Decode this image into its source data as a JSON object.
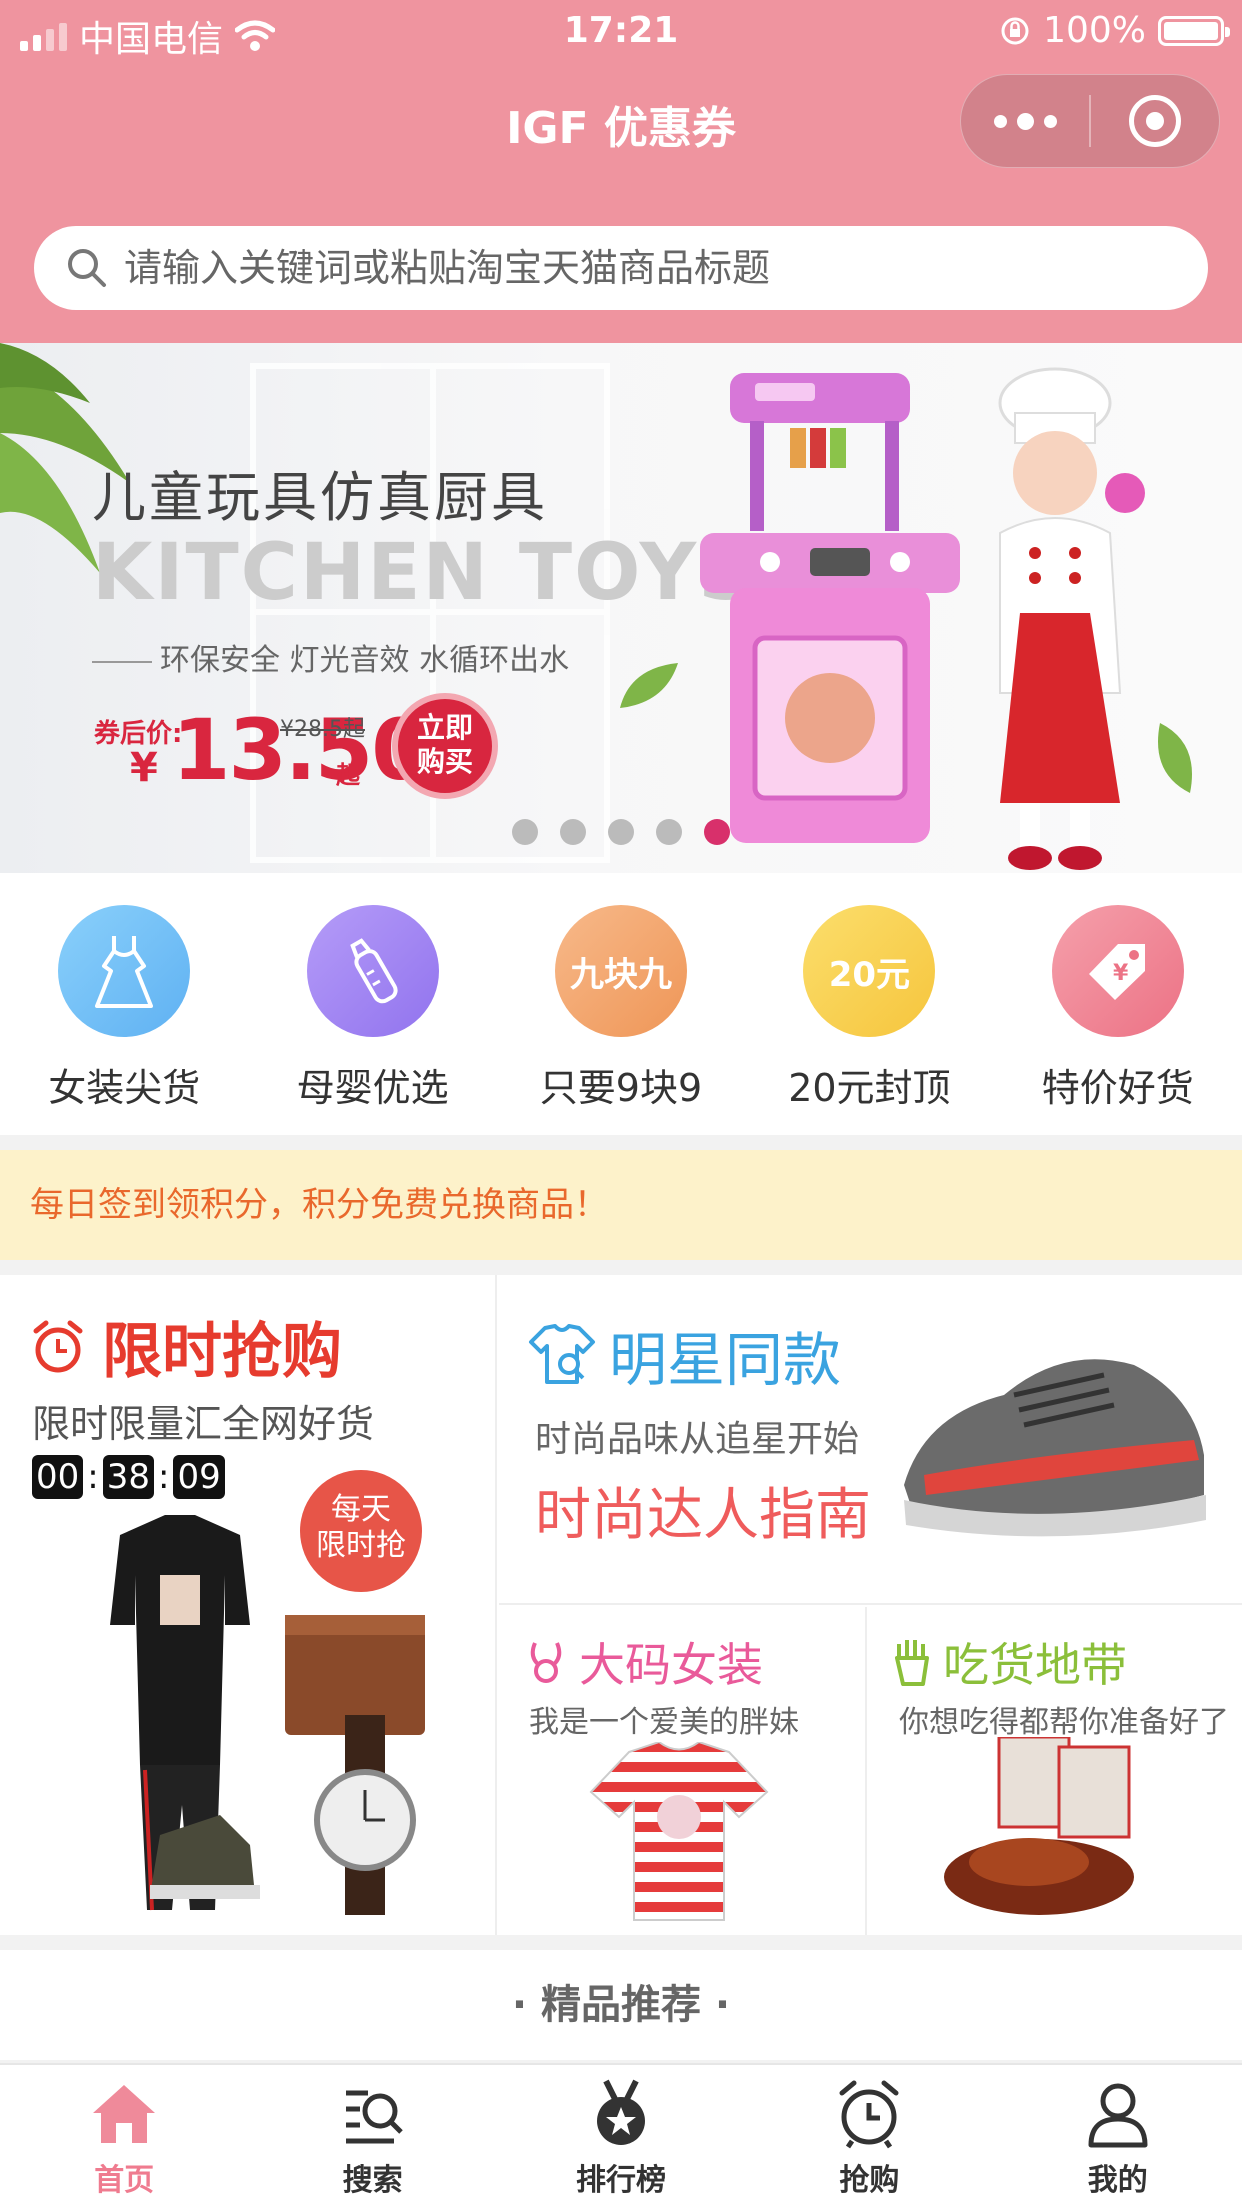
{
  "status_bar": {
    "carrier": "中国电信",
    "time": "17:21",
    "battery": "100%"
  },
  "nav": {
    "title": "IGF 优惠券"
  },
  "search": {
    "placeholder": "请输入关键词或粘贴淘宝天猫商品标题"
  },
  "banner": {
    "title": "儿童玩具仿真厨具",
    "english": "KITCHEN TOYS",
    "subtitle": "环保安全 灯光音效 水循环出水",
    "price_label": "券后价:",
    "currency": "¥",
    "price": "13.50",
    "price_suffix": "起",
    "old_price": "¥28.5起",
    "buy_label_1": "立即",
    "buy_label_2": "购买",
    "active_slide": 5,
    "slide_count": 5
  },
  "categories": [
    {
      "label": "女装尖货",
      "icon": "dress-icon",
      "color": "#7cc4f8"
    },
    {
      "label": "母婴优选",
      "icon": "baby-bottle-icon",
      "color": "#a98af5"
    },
    {
      "label": "只要9块9",
      "icon": "nine-nine-icon",
      "icon_text": "九块九",
      "color": "#f3a56a"
    },
    {
      "label": "20元封顶",
      "icon": "twenty-yuan-icon",
      "icon_text": "20元",
      "color": "#f8cd52"
    },
    {
      "label": "特价好货",
      "icon": "price-tag-icon",
      "color": "#f08595"
    }
  ],
  "notice": {
    "text": "每日签到领积分，积分免费兑换商品！"
  },
  "promo": {
    "flash": {
      "title": "限时抢购",
      "subtitle": "限时限量汇全网好货",
      "timer": [
        "00",
        "38",
        "09"
      ],
      "badge_1": "每天",
      "badge_2": "限时抢"
    },
    "star": {
      "title": "明星同款",
      "subtitle": "时尚品味从追星开始",
      "tagline": "时尚达人指南"
    },
    "plus": {
      "title": "大码女装",
      "subtitle": "我是一个爱美的胖妹"
    },
    "food": {
      "title": "吃货地带",
      "subtitle": "你想吃得都帮你准备好了"
    }
  },
  "recommend": {
    "title": "精品推荐"
  },
  "tabs": [
    {
      "label": "首页",
      "icon": "home-icon",
      "active": true
    },
    {
      "label": "搜索",
      "icon": "search-list-icon",
      "active": false
    },
    {
      "label": "排行榜",
      "icon": "medal-icon",
      "active": false
    },
    {
      "label": "抢购",
      "icon": "alarm-clock-icon",
      "active": false
    },
    {
      "label": "我的",
      "icon": "user-icon",
      "active": false
    }
  ],
  "colors": {
    "header": "#ef949f",
    "accent": "#e63b2e",
    "notice_bg": "#fdf2ca",
    "tab_active": "#ef7b8f"
  }
}
